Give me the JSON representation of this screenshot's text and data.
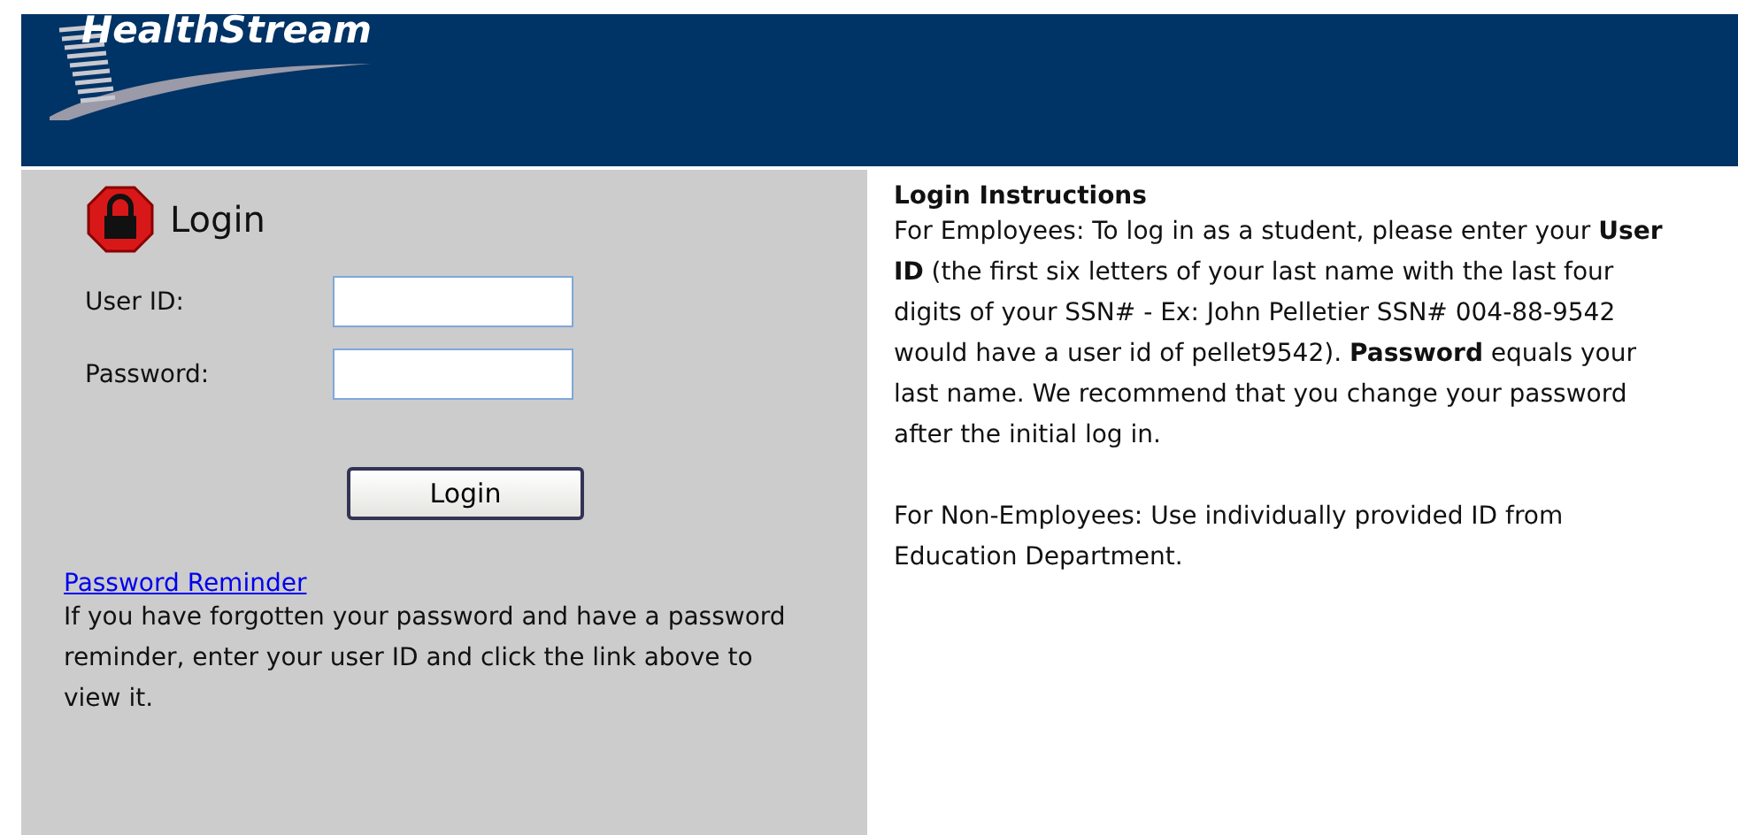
{
  "header": {
    "logo": "HealthStream"
  },
  "login": {
    "title": "Login",
    "fields": [
      {
        "label": "User ID:"
      },
      {
        "label": "Password:"
      }
    ],
    "button": "Login",
    "reminder_link": "Password Reminder",
    "reminder_text": "If you have forgotten your password and have a password reminder, enter your user ID and click the link above to view it."
  },
  "instructions": {
    "title": "Login Instructions",
    "paragraphs": [
      "For Employees: To log in as a student, please enter your **User ID** (the first six letters of your last name with the last four digits of your SSN# - Ex: John Pelletier SSN# 004-88-9542 would have a user id of pellet9542). **Password** equals your last name. We recommend that you change your password after the initial log in.",
      "For Non-Employees: Use individually provided ID from Education Department."
    ]
  }
}
